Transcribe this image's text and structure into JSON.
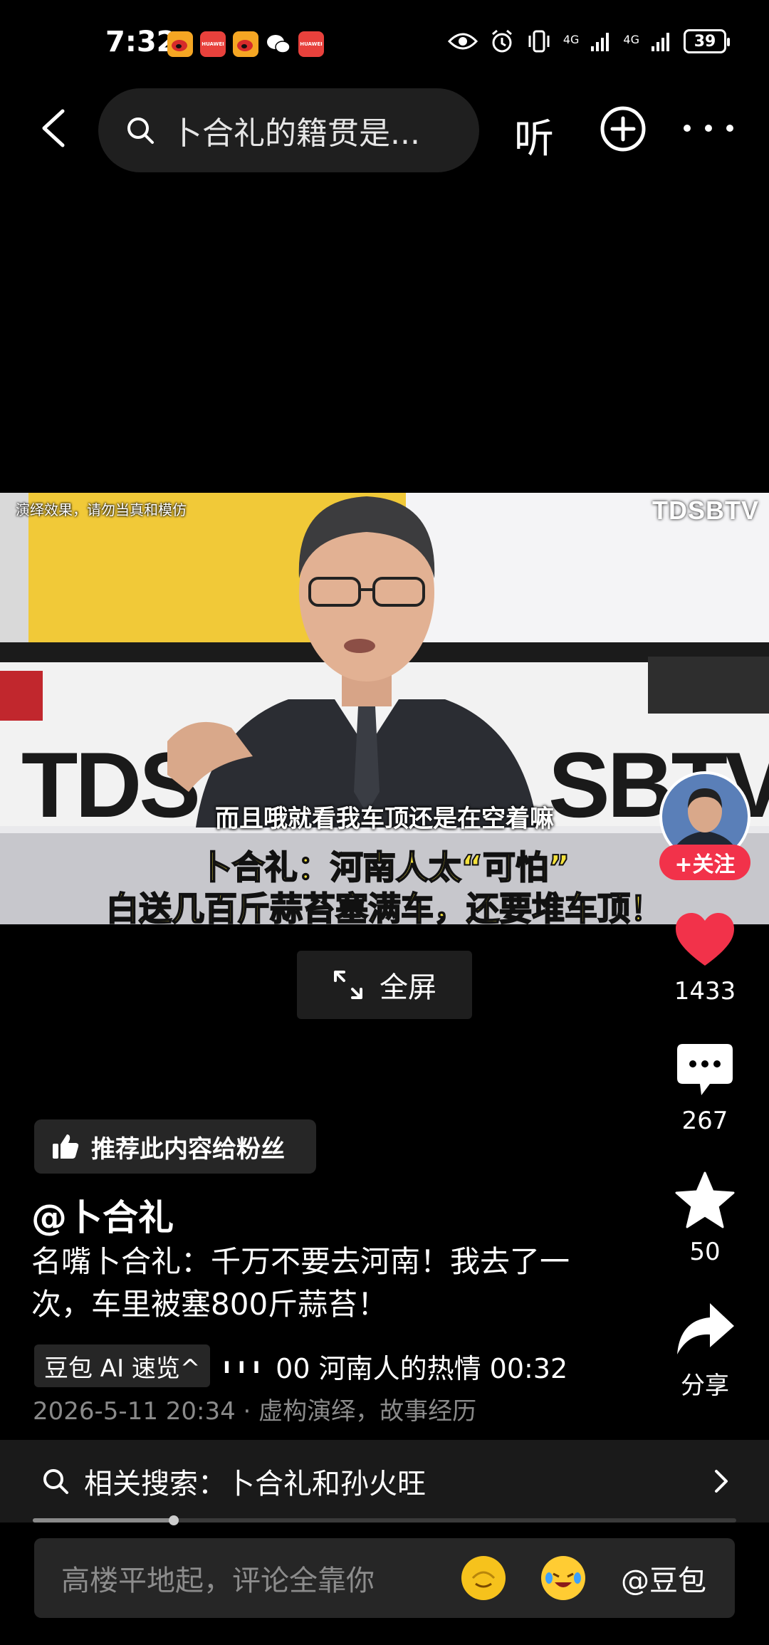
{
  "status_bar": {
    "time": "7:32",
    "notifications": [
      {
        "name": "weibo-icon",
        "label": "",
        "color": "#f5a623"
      },
      {
        "name": "huawei-icon",
        "label": "HUAWEI",
        "color": "#e8413c"
      },
      {
        "name": "weibo-icon-2",
        "label": "",
        "color": "#f5a623"
      },
      {
        "name": "wechat-icon",
        "label": "",
        "color": "#ffffff"
      },
      {
        "name": "huawei-icon-2",
        "label": "HUAWEI",
        "color": "#e8413c"
      }
    ],
    "network_1": "4G",
    "network_2": "4G",
    "battery": "39"
  },
  "top_nav": {
    "search_query": "卜合礼的籍贯是...",
    "listen_label": "听"
  },
  "video": {
    "top_note": "演绎效果，请勿当真和模仿",
    "watermark": "TDSBTV",
    "backdrop_logo_left": "TDS",
    "backdrop_logo_right": "SBTV",
    "subtitle": "而且哦就看我车顶还是在空着嘛",
    "caption_line1": "卜合礼：河南人太“可怕”",
    "caption_line2": "白送几百斤蒜苔塞满车，还要堆车顶！"
  },
  "follow_label": "+关注",
  "fullscreen_label": "全屏",
  "actions": {
    "likes": "1433",
    "comments": "267",
    "favorites": "50",
    "share_label": "分享"
  },
  "recommend_label": "推荐此内容给粉丝",
  "author": "@卜合礼",
  "description": "名嘴卜合礼：千万不要去河南！我去了一次，车里被塞800斤蒜苔！",
  "ai_summary": {
    "badge": "豆包 AI 速览^",
    "chapter_text": "00 河南人的热情    00:32"
  },
  "meta": "2026-5-11 20:34 · 虚构演绎，故事经历",
  "related_search": {
    "label": "相关搜索：",
    "query": "卜合礼和孙火旺"
  },
  "playback_progress": 0.2,
  "comment_bar": {
    "placeholder": "高楼平地起，评论全靠你",
    "mention": "@豆包"
  },
  "colors": {
    "accent_red": "#f2324a",
    "caption_yellow": "#f5e23c",
    "background": "#000000"
  }
}
